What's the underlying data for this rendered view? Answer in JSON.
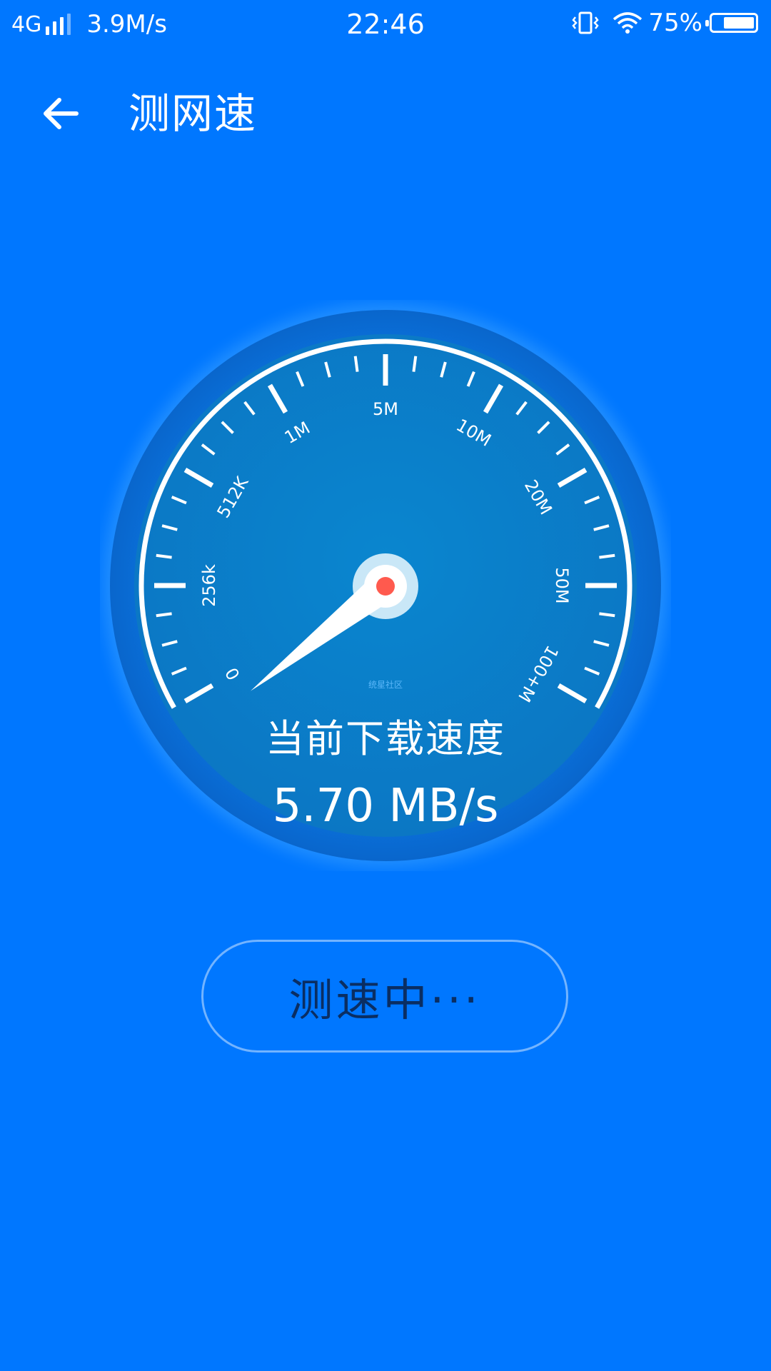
{
  "status_bar": {
    "network": "4G",
    "speed": "3.9M/s",
    "time": "22:46",
    "battery_percent": "75%",
    "battery_level": 0.75,
    "icons": [
      "signal-icon",
      "vibrate-icon",
      "wifi-icon",
      "battery-icon"
    ]
  },
  "header": {
    "back_icon": "arrow-left-icon",
    "title": "测网速"
  },
  "gauge": {
    "scale_labels": [
      "0",
      "256k",
      "512K",
      "1M",
      "5M",
      "10M",
      "20M",
      "50M",
      "100+M"
    ],
    "needle_position_label": "0",
    "watermark": "统星社区",
    "current_label": "当前下载速度",
    "current_value": "5.70 MB/s"
  },
  "action_button": {
    "label": "测速中···"
  },
  "colors": {
    "background": "#0077ff",
    "dial_outer": "#0a6fd6",
    "dial_inner": "#0a82c8",
    "needle_dot": "#ff5a4e",
    "button_text": "#0a2e63"
  }
}
